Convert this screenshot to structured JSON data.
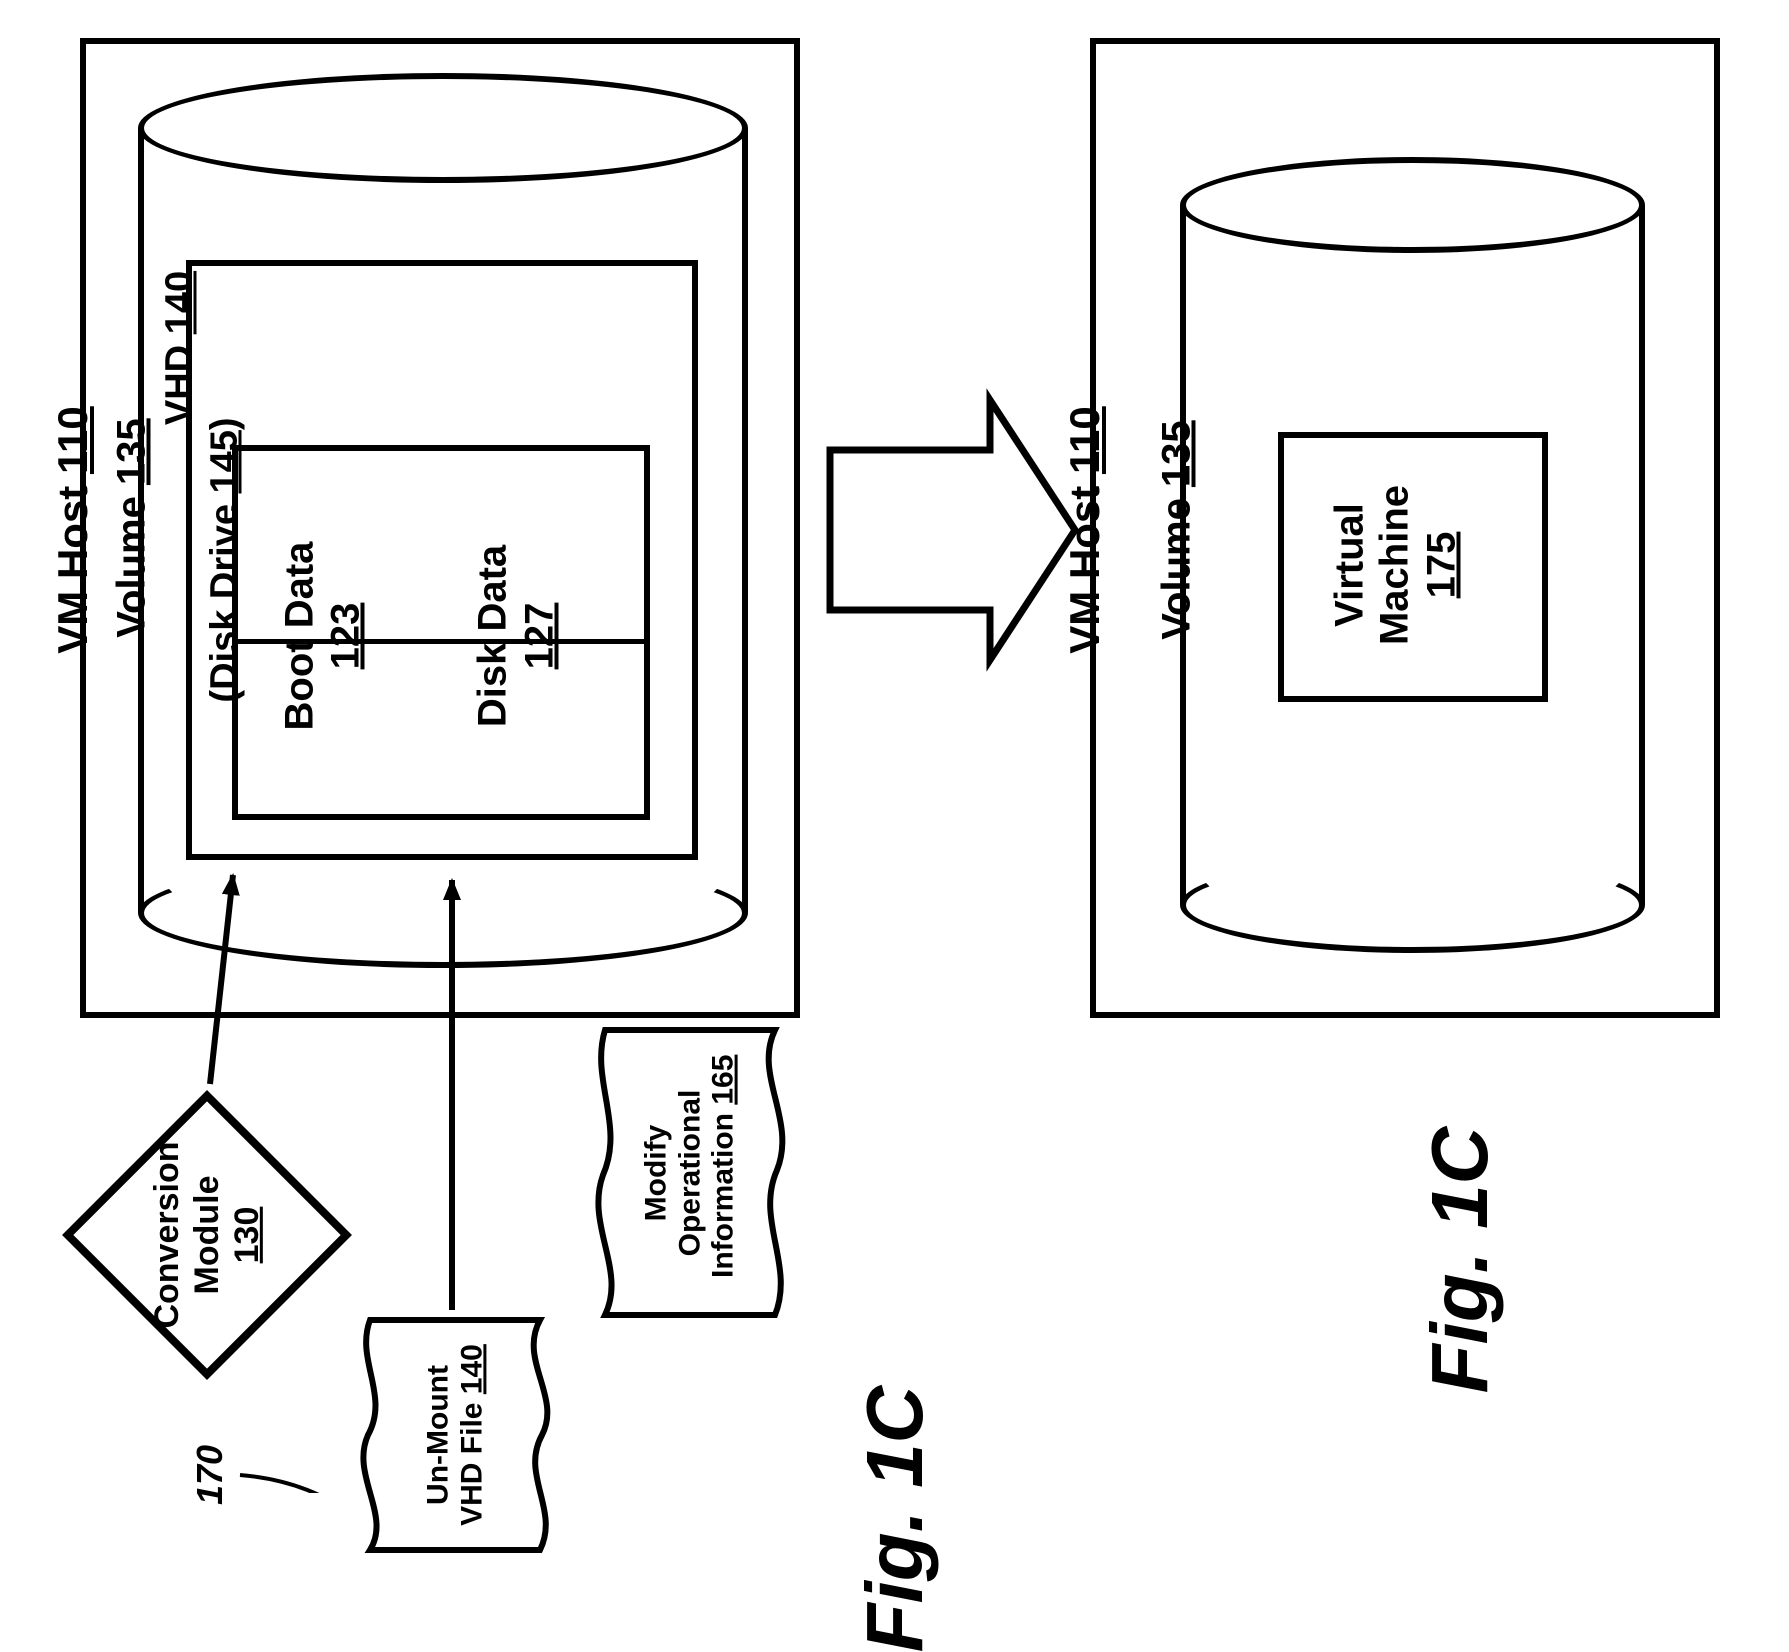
{
  "figure": {
    "caption": "Fig. 1C"
  },
  "refs": {
    "unmount_leader": "170"
  },
  "top_state": {
    "host": {
      "label_prefix": "VM Host ",
      "number": "110"
    },
    "volume": {
      "label_prefix": "Volume ",
      "number": "135"
    },
    "vhd": {
      "line1_prefix": "VHD ",
      "line1_num": "140",
      "line2_prefix": "(Disk Drive ",
      "line2_num": "145",
      "line2_suffix": ")"
    },
    "boot": {
      "label": "Boot Data",
      "number": "123"
    },
    "disk": {
      "label": "Disk Data",
      "number": "127"
    }
  },
  "bottom_state": {
    "host": {
      "label_prefix": "VM Host ",
      "number": "110"
    },
    "volume": {
      "label_prefix": "Volume ",
      "number": "135"
    },
    "vm": {
      "line1": "Virtual",
      "line2": "Machine",
      "number": "175"
    }
  },
  "conversion": {
    "line1": "Conversion",
    "line2": "Module",
    "number": "130"
  },
  "msg_modify": {
    "line1": "Modify",
    "line2": "Operational",
    "line3_prefix": "Information ",
    "line3_num": "165"
  },
  "msg_unmount": {
    "line1": "Un-Mount",
    "line2_prefix": "VHD File ",
    "line2_num": "140"
  }
}
